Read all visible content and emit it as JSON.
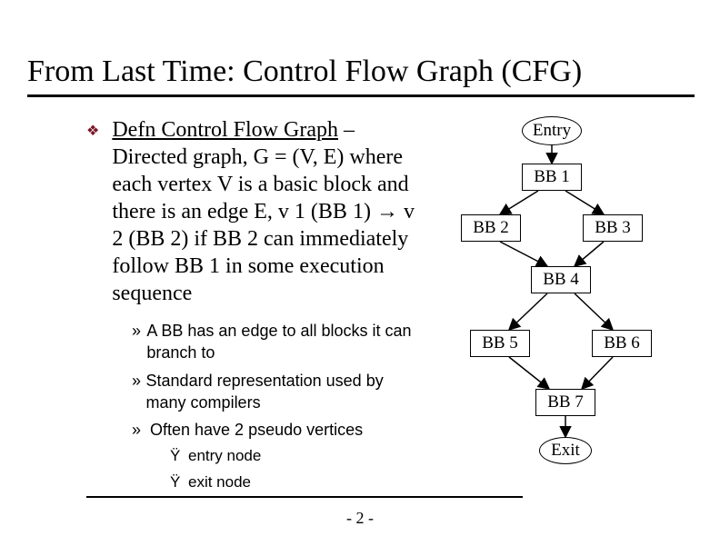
{
  "title": "From Last Time: Control Flow Graph (CFG)",
  "defn": {
    "lead": "Defn Control Flow Graph",
    "dash": " – ",
    "l2": "Directed graph, G = (V, E) where each vertex V is a basic block and there is an edge E, v 1 (BB 1) ",
    "arrow": "→",
    "l2b": " v 2 (BB 2) if BB 2 can immediately follow BB 1 in some execution sequence"
  },
  "sub": {
    "b1": "A BB has an edge to all blocks it can branch to",
    "b2": "Standard representation used by many compilers",
    "b3": "Often have 2 pseudo vertices",
    "s1": "entry node",
    "s2": "exit node"
  },
  "bullets": {
    "diamond": "❖",
    "raquo": "»",
    "dot": "Ÿ"
  },
  "page": "- 2 -",
  "chart_data": {
    "type": "diagram",
    "title": "Control Flow Graph",
    "nodes": [
      {
        "id": "entry",
        "label": "Entry",
        "shape": "ellipse"
      },
      {
        "id": "bb1",
        "label": "BB 1",
        "shape": "rect"
      },
      {
        "id": "bb2",
        "label": "BB 2",
        "shape": "rect"
      },
      {
        "id": "bb3",
        "label": "BB 3",
        "shape": "rect"
      },
      {
        "id": "bb4",
        "label": "BB 4",
        "shape": "rect"
      },
      {
        "id": "bb5",
        "label": "BB 5",
        "shape": "rect"
      },
      {
        "id": "bb6",
        "label": "BB 6",
        "shape": "rect"
      },
      {
        "id": "bb7",
        "label": "BB 7",
        "shape": "rect"
      },
      {
        "id": "exit",
        "label": "Exit",
        "shape": "ellipse"
      }
    ],
    "edges": [
      [
        "entry",
        "bb1"
      ],
      [
        "bb1",
        "bb2"
      ],
      [
        "bb1",
        "bb3"
      ],
      [
        "bb2",
        "bb4"
      ],
      [
        "bb3",
        "bb4"
      ],
      [
        "bb4",
        "bb5"
      ],
      [
        "bb4",
        "bb6"
      ],
      [
        "bb5",
        "bb7"
      ],
      [
        "bb6",
        "bb7"
      ],
      [
        "bb7",
        "exit"
      ]
    ]
  }
}
